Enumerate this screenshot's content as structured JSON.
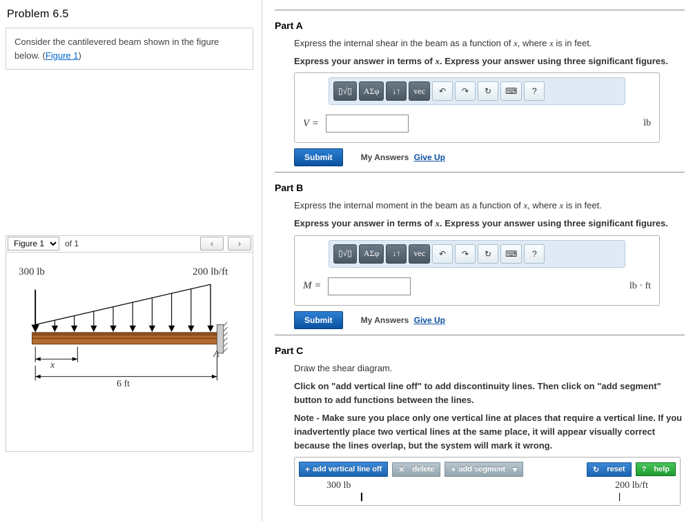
{
  "problem_title": "Problem 6.5",
  "prompt": {
    "text_before_link": "Consider the cantilevered beam shown in the figure below. (",
    "link_text": "Figure 1",
    "text_after_link": ")"
  },
  "figure_selector": {
    "selected": "Figure 1",
    "of_text": "of 1",
    "prev": "‹",
    "next": "›"
  },
  "beam": {
    "point_load_label": "300 lb",
    "dist_load_label": "200 lb/ft",
    "x_label": "x",
    "A_label": "A",
    "span_label": "6 ft"
  },
  "parts": {
    "A": {
      "title": "Part A",
      "instr1_before": "Express the internal shear in the beam as a function of ",
      "instr1_var": "x",
      "instr1_mid": ", where ",
      "instr1_after": " is in feet.",
      "instr2_before": "Express your answer in terms of ",
      "instr2_var": "x",
      "instr2_after": ". Express your answer using three significant figures.",
      "var_label": "V =",
      "unit": "lb"
    },
    "B": {
      "title": "Part B",
      "instr1_before": "Express the internal moment in the beam as a function of ",
      "instr1_var": "x",
      "instr1_mid": ", where ",
      "instr1_after": " is in feet.",
      "instr2_before": "Express your answer in terms of ",
      "instr2_var": "x",
      "instr2_after": ". Express your answer using three significant figures.",
      "var_label": "M =",
      "unit": "lb · ft"
    },
    "C": {
      "title": "Part C",
      "instr1": "Draw the shear diagram.",
      "instr2": "Click on \"add vertical line off\" to add discontinuity lines. Then click on \"add segment\" button to add functions between the lines.",
      "instr3": "Note - Make sure you place only one vertical line at places that require a vertical line. If you inadvertently place two vertical lines at the same place, it will appear visually correct because the lines overlap, but the system will mark it wrong."
    }
  },
  "toolbar": {
    "btn_template": "▯√▯",
    "btn_greek": "ΑΣφ",
    "btn_arrows": "↓↑",
    "btn_vec": "vec",
    "undo": "↶",
    "redo": "↷",
    "reset": "↻",
    "keyboard": "⌨",
    "help": "?"
  },
  "submit": {
    "button": "Submit",
    "my_answers": "My Answers",
    "give_up": "Give Up"
  },
  "graph_toolbar": {
    "add_vline": "add vertical line off",
    "delete": "delete",
    "add_segment": "add segment",
    "reset": "reset",
    "help": "help"
  },
  "graph_labels": {
    "left": "300 lb",
    "right": "200 lb/ft"
  }
}
